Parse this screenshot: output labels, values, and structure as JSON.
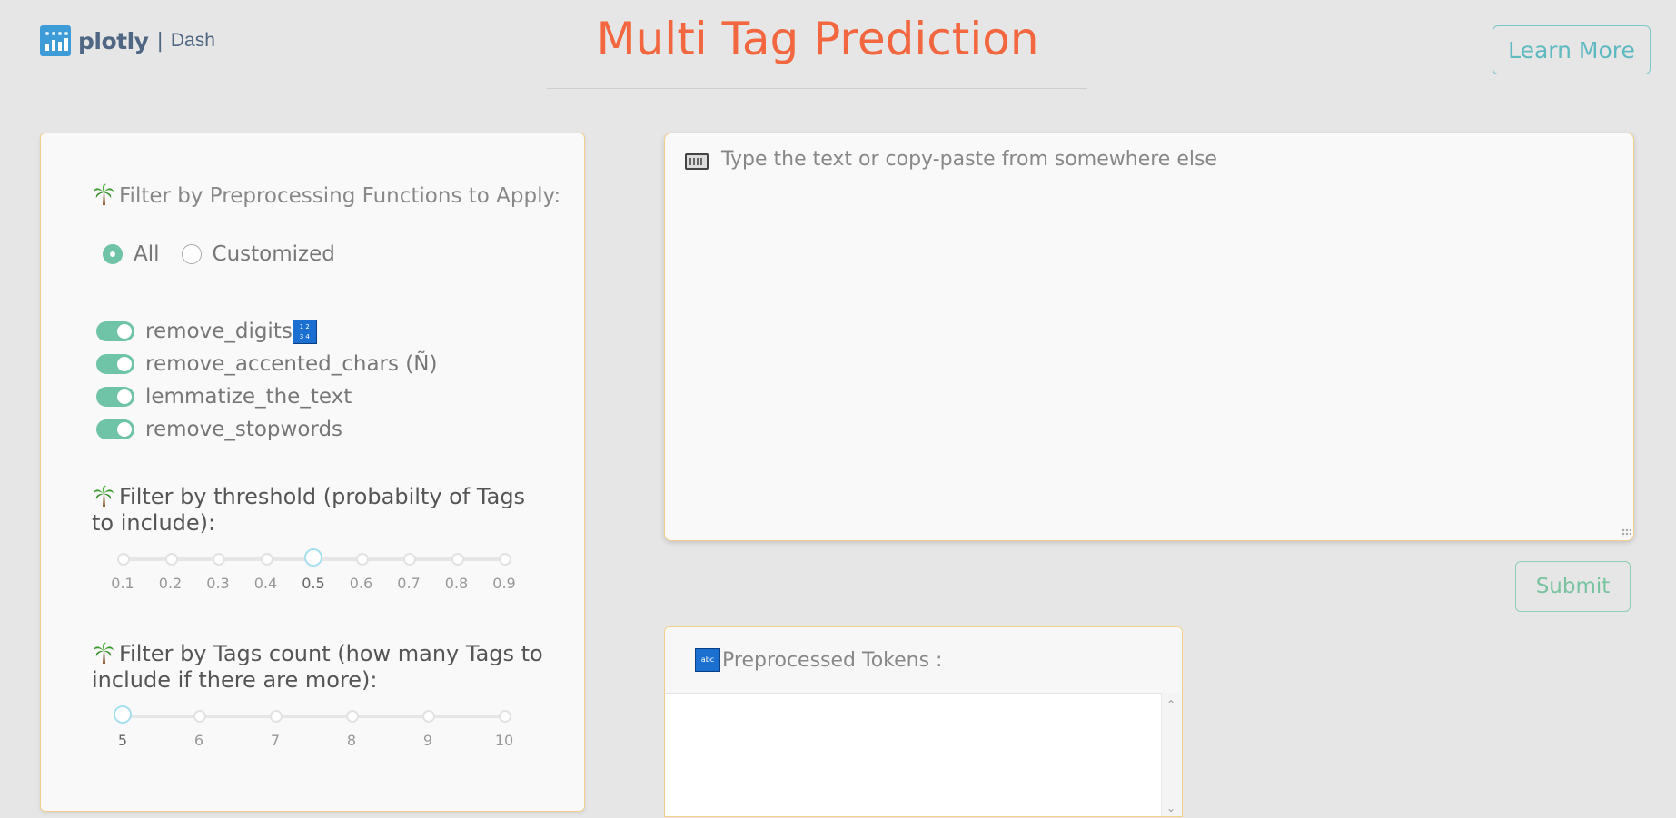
{
  "header": {
    "logo_brand": "plotly",
    "logo_product": "Dash",
    "title": "Multi Tag Prediction",
    "learn_more_label": "Learn More"
  },
  "filters": {
    "preprocessing_label": "Filter by Preprocessing Functions to Apply:",
    "mode_options": [
      "All",
      "Customized"
    ],
    "mode_selected": "All",
    "functions": [
      {
        "label": "remove_digits",
        "enabled": true,
        "icon": "digits-icon"
      },
      {
        "label": "remove_accented_chars (Ñ)",
        "enabled": true
      },
      {
        "label": "lemmatize_the_text",
        "enabled": true
      },
      {
        "label": "remove_stopwords",
        "enabled": true
      }
    ],
    "threshold_label": "Filter by threshold (probabilty of Tags to include):",
    "threshold": {
      "marks": [
        "0.1",
        "0.2",
        "0.3",
        "0.4",
        "0.5",
        "0.6",
        "0.7",
        "0.8",
        "0.9"
      ],
      "value": 0.5
    },
    "count_label": "Filter by Tags count (how many Tags to include if there are more):",
    "count": {
      "marks": [
        "5",
        "6",
        "7",
        "8",
        "9",
        "10"
      ],
      "value": 5
    },
    "section_icon": "palm-tree-icon"
  },
  "input": {
    "placeholder": "Type the text or copy-paste from somewhere else",
    "value": "",
    "icon": "keyboard-icon"
  },
  "submit_label": "Submit",
  "tokens": {
    "title": "Preprocessed Tokens :",
    "icon": "abc-icon"
  }
}
